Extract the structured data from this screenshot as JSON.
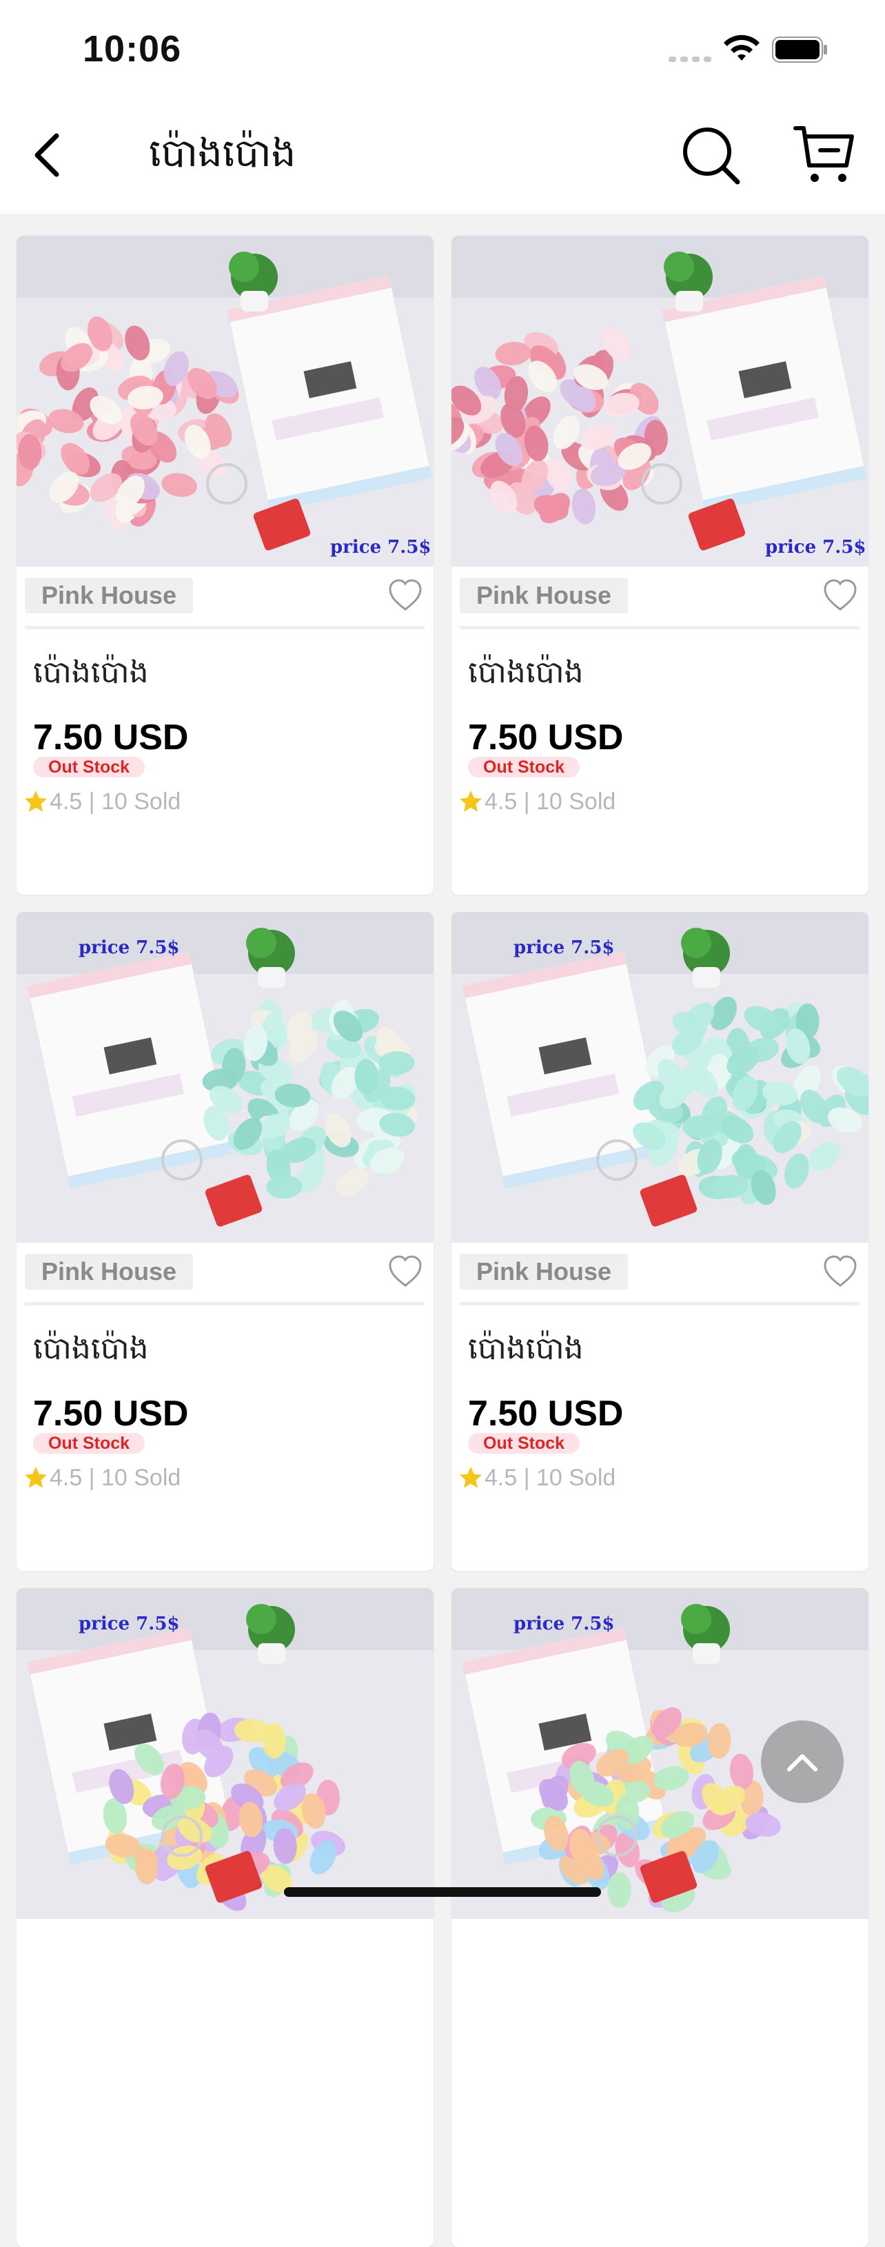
{
  "status": {
    "time": "10:06"
  },
  "nav": {
    "title": "ប៉ោងប៉ោង",
    "back_icon": "chevron-left-icon",
    "search_icon": "search-icon",
    "cart_icon": "cart-icon"
  },
  "colors": {
    "out_stock_text": "#e02424",
    "out_stock_bg": "#fde3e7",
    "star": "#f5c518"
  },
  "products": [
    {
      "shop": "Pink House",
      "name": "ប៉ោងប៉ោង",
      "price": "7.50 USD",
      "stock": "Out Stock",
      "rating": "4.5 | 10 Sold",
      "balloon_theme": "pink"
    },
    {
      "shop": "Pink House",
      "name": "ប៉ោងប៉ោង",
      "price": "7.50 USD",
      "stock": "Out Stock",
      "rating": "4.5 | 10 Sold",
      "balloon_theme": "pink"
    },
    {
      "shop": "Pink House",
      "name": "ប៉ោងប៉ោង",
      "price": "7.50 USD",
      "stock": "Out Stock",
      "rating": "4.5 | 10 Sold",
      "balloon_theme": "mint"
    },
    {
      "shop": "Pink House",
      "name": "ប៉ោងប៉ោង",
      "price": "7.50 USD",
      "stock": "Out Stock",
      "rating": "4.5 | 10 Sold",
      "balloon_theme": "mint"
    },
    {
      "shop": "",
      "name": "",
      "price": "",
      "stock": "",
      "rating": "",
      "balloon_theme": "pastel"
    },
    {
      "shop": "",
      "name": "",
      "price": "",
      "stock": "",
      "rating": "",
      "balloon_theme": "pastel"
    }
  ],
  "image_text": {
    "price_tag": "price 7.5$"
  }
}
